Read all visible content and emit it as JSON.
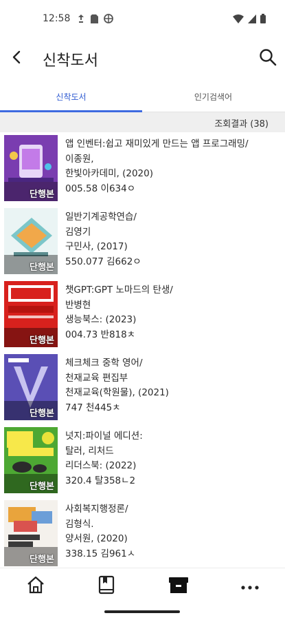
{
  "status": {
    "time": "12:58"
  },
  "app_bar": {
    "title": "신착도서"
  },
  "tabs": [
    {
      "label": "신착도서"
    },
    {
      "label": "인기검색어"
    }
  ],
  "result": {
    "text": "조회결과 (38)"
  },
  "books": [
    {
      "title": "앱 인벤터:쉽고 재미있게 만드는 앱 프로그래밍/",
      "author": "이종원,",
      "publisher": "한빛아카데미, (2020)",
      "call_no": "005.58 이634ㅇ",
      "badge": "단행본",
      "cover_color": "#7a3db0"
    },
    {
      "title": "일반기계공학연습/",
      "author": "김영기",
      "publisher": "구민사, (2017)",
      "call_no": "550.077 김662ㅇ",
      "badge": "단행본",
      "cover_color": "#7cc6c9"
    },
    {
      "title": "챗GPT:GPT 노마드의 탄생/",
      "author": "반병현",
      "publisher": "생능북스: (2023)",
      "call_no": "004.73 반818ㅊ",
      "badge": "단행본",
      "cover_color": "#d8211d"
    },
    {
      "title": "체크체크 중학 영어/",
      "author": "천재교육 편집부",
      "publisher": "천재교육(학원물), (2021)",
      "call_no": "747 천445ㅊ",
      "badge": "단행본",
      "cover_color": "#5a4fb5"
    },
    {
      "title": "넛지:파이널 에디션:",
      "author": "탈러, 리처드",
      "publisher": "리더스북: (2022)",
      "call_no": "320.4 탈358ㄴ2",
      "badge": "단행본",
      "cover_color": "#4da833"
    },
    {
      "title": "사회복지행정론/",
      "author": "김형식.",
      "publisher": "양서원, (2020)",
      "call_no": "338.15 김961ㅅ",
      "badge": "단행본",
      "cover_color": "#e9e4dc"
    }
  ]
}
